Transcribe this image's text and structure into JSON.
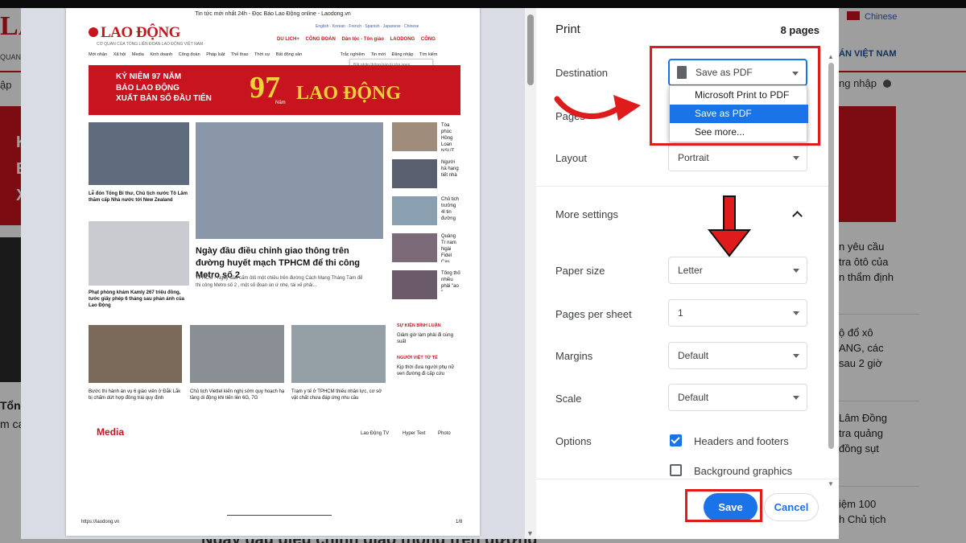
{
  "background_site": {
    "logo_fragment": "LA",
    "quan_fragment": "QUAN",
    "nhap_fragment": "ập",
    "red_left_letters": [
      "K",
      "E",
      "X"
    ],
    "left_fragments": [
      "Tổng",
      "m ca"
    ],
    "chinese_label": "Chinese",
    "vietnam_label": "ÁN VIỆT NAM",
    "login_label": "ng nhập",
    "right_headlines": [
      "n yêu cầu\ntra ôtô của\nn thẩm định",
      "ộ đổ xô\nANG, các\nsau 2 giờ",
      "Lâm Đồng\ntra quảng\nđồng sụt",
      "iệm 100\nh Chủ tịch"
    ],
    "bottom_fragment": "Ngày đầu điều chỉnh giao thông trên đường"
  },
  "preview": {
    "page_header": "Tin tức mới nhất 24h - Đọc Báo Lao Động online - Laodong.vn",
    "logo": "LAO ĐỘNG",
    "tagline": "CƠ QUAN CỦA TỔNG LIÊN ĐOÀN LAO ĐỘNG VIỆT NAM",
    "languages": "English · Korean · French · Spanish · Japanese · Chinese",
    "chips": [
      "DU LỊCH+",
      "CÔNG ĐOÀN",
      "Dân tộc - Tôn giáo",
      "LAODONG",
      "CÔNG"
    ],
    "nav_items": [
      "Mới nhận",
      "Xã hội",
      "Media",
      "Kinh doanh",
      "Công đoàn",
      "Pháp luật",
      "Thế thao",
      "Thời sự",
      "Bất động sản",
      "Trắc nghiệm",
      "Tin mới",
      "Đăng nhập",
      "Tìm kiếm"
    ],
    "popup": "Bật nhận thông báo từ tòa soạn",
    "banner_lines": [
      "KỶ NIỆM 97 NĂM",
      "BÁO LAO ĐỘNG",
      "XUẤT BẢN SỐ ĐẦU TIÊN"
    ],
    "banner_num": "97",
    "banner_nam": "Năm",
    "banner_brand": "LAO ĐỘNG",
    "left_story_1": "Lễ đón Tổng Bí thư, Chủ tịch nước Tô Lâm thăm cấp Nhà nước tới New Zealand",
    "left_story_2": "Phạt phòng khám Kamly 267 triệu đồng, tước giấy phép 6 tháng sau phản ánh của Lao Động",
    "main_title": "Ngày đầu điều chỉnh giao thông trên đường huyết mạch TPHCM để thi công Metro số 2",
    "main_sub": "TPHCM - Ngày đầu cấm ôtô một chiều trên đường Cách Mạng Tháng Tám để thi công Metro số 2 , một số đoạn ùn ứ nhẹ, tài xế phải...",
    "side_stories": [
      "Tòa phúc Hồng Loan NSUT Vũ sự nghiệp",
      "Người hà hạng tiết nhà",
      "Chủ tịch trưởng 4l tin đường",
      "Quảng Tr nam Ngài Fidel Cas",
      "Tổng thố nhiều phải \"ao \""
    ],
    "bottom_stories": [
      "Bước thi hành án vụ 6 giáo viên ở Đắk Lắk bị chấm dứt hợp đồng trái quy định",
      "Chủ tịch Viettel kiến nghị sớm quy hoạch hạ tầng di động khi tiến lên 6G, 7G",
      "Trạm y tế ở TPHCM thiếu nhân lực, cơ sở vật chất chưa đáp ứng nhu cầu"
    ],
    "sec_1": "SỰ KIỆN BÌNH LUẬN",
    "sec_1_story": "Giảm giờ làm phải đi cùng suất",
    "sec_2": "NGƯỜI VIỆT TỬ TẾ",
    "sec_2_story": "Kịp thời đưa người phụ nữ ven đường đi cấp cứu",
    "media_label": "Media",
    "media_tabs": [
      "Lao Động TV",
      "Hyper Text",
      "Photo"
    ],
    "footer_url": "https://laodong.vn",
    "footer_page": "1/8"
  },
  "dialog": {
    "title": "Print",
    "pages_count": "8 pages",
    "destination_label": "Destination",
    "destination_value": "Save as PDF",
    "destination_options": [
      "Microsoft Print to PDF",
      "Save as PDF",
      "See more..."
    ],
    "pages_label": "Pages",
    "layout_label": "Layout",
    "layout_value": "Portrait",
    "more_settings_label": "More settings",
    "paper_size_label": "Paper size",
    "paper_size_value": "Letter",
    "pages_per_sheet_label": "Pages per sheet",
    "pages_per_sheet_value": "1",
    "margins_label": "Margins",
    "margins_value": "Default",
    "scale_label": "Scale",
    "scale_value": "Default",
    "options_label": "Options",
    "headers_footers_label": "Headers and footers",
    "headers_footers_checked": true,
    "background_graphics_label": "Background graphics",
    "background_graphics_checked": false,
    "save_label": "Save",
    "cancel_label": "Cancel"
  },
  "colors": {
    "accent": "#1a73e8",
    "brand_red": "#c8141e",
    "annotation_red": "#e01b1b"
  }
}
